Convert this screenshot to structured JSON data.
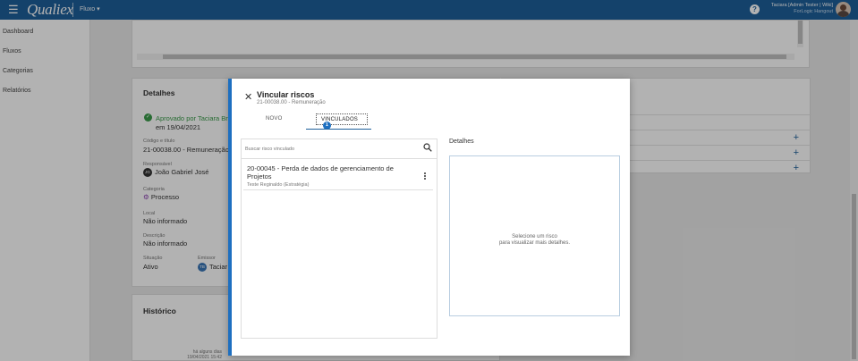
{
  "topbar": {
    "menu_icon": "menu-icon",
    "logo": "Qualiex",
    "module": "Fluxo",
    "help_icon": "?",
    "user_name": "Taciara [Admin Tester | Wiki]",
    "user_org": "ForLogic Hangout"
  },
  "sidebar": {
    "items": [
      {
        "label": "Dashboard"
      },
      {
        "label": "Fluxos"
      },
      {
        "label": "Categorias"
      },
      {
        "label": "Relatórios"
      }
    ]
  },
  "details": {
    "title": "Detalhes",
    "approved": "Aprovado por Taciara Bru",
    "approved_date": "em 19/04/2021",
    "code_label": "Código e título",
    "code_value": "21-00038.00 - Remuneração",
    "responsible_label": "Responsável",
    "responsible_initials": "JG",
    "responsible_value": "João Gabriel José",
    "category_label": "Categoria",
    "category_value": "Processo",
    "local_label": "Local",
    "local_value": "Não informado",
    "description_label": "Descrição",
    "description_value": "Não informado",
    "situation_label": "Situação",
    "situation_value": "Ativo",
    "emitter_label": "Emissor",
    "emitter_initials": "TB",
    "emitter_value": "Taciar"
  },
  "history": {
    "title": "Histórico",
    "time_ago": "há alguns dias",
    "timestamp": "19/04/2021 15:42"
  },
  "dialog": {
    "title": "Vincular riscos",
    "subtitle": "21-00038.00 - Remuneração",
    "tabs": {
      "novo": "NOVO",
      "vinculados": "VINCULADOS",
      "vinculados_count": "1"
    },
    "search_placeholder": "Buscar risco vinculado",
    "items": [
      {
        "title": "20-00045 - Perda de dados de gerenciamento de Projetos",
        "subtitle": "Teste Reginaldo (Estratégia)"
      }
    ],
    "details_label": "Detalhes",
    "details_empty_line1": "Selecione um risco",
    "details_empty_line2": "para visualizar mais detalhes."
  },
  "colors": {
    "primary": "#1d5f9a",
    "accent": "#1d6fc0",
    "success": "#3a9b4a"
  }
}
